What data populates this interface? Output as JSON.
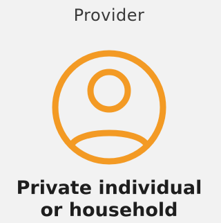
{
  "card": {
    "label": "Provider",
    "icon": "user-circle-icon",
    "title_line1": "Private individual",
    "title_line2": "or household"
  },
  "colors": {
    "background": "#f2f2f2",
    "icon": "#f39a24",
    "label_text": "#3a3a3a",
    "title_text": "#1e1e1e"
  }
}
